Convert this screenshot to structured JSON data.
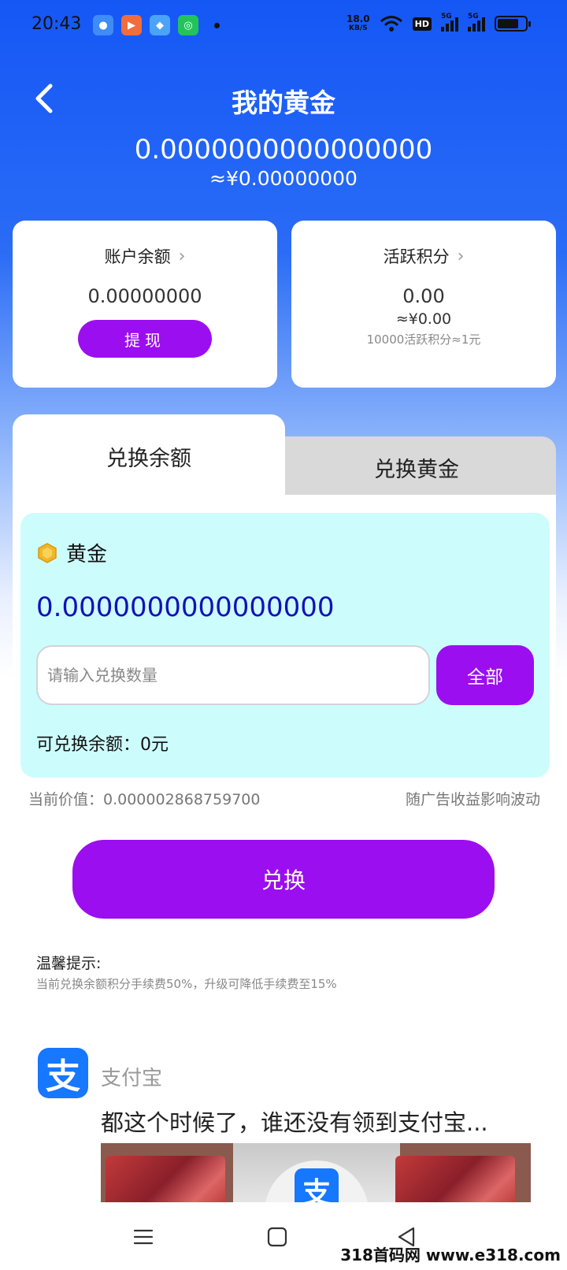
{
  "statusbar": {
    "time": "20:43",
    "net_speed_value": "18.0",
    "net_speed_unit": "KB/S",
    "hd_label": "HD",
    "signal1_label": "5G",
    "signal2_label": "5G",
    "icons": [
      "app-icon-1",
      "app-icon-2",
      "app-icon-3",
      "app-icon-4",
      "wifi-icon",
      "battery-icon"
    ],
    "battery_level": 0.75
  },
  "header": {
    "title": "我的黄金",
    "gold_total": "0.0000000000000000",
    "gold_cny": "≈¥0.00000000"
  },
  "balance_card": {
    "title": "账户余额",
    "value": "0.00000000",
    "button_label": "提现"
  },
  "points_card": {
    "title": "活跃积分",
    "value": "0.00",
    "cny": "≈¥0.00",
    "note": "10000活跃积分≈1元"
  },
  "tabs": [
    {
      "label": "兑换余额",
      "active": true
    },
    {
      "label": "兑换黄金",
      "active": false
    }
  ],
  "exchange": {
    "asset_label": "黄金",
    "asset_amount": "0.0000000000000000",
    "input_placeholder": "请输入兑换数量",
    "input_value": "",
    "all_button": "全部",
    "available": "可兑换余额：0元",
    "price_text": "当前价值：0.000002868759700",
    "fluctuation_text": "随广告收益影响波动",
    "submit_label": "兑换"
  },
  "tips": {
    "title": "温馨提示:",
    "text": "当前兑换余额积分手续费50%，升级可降低手续费至15%"
  },
  "ad": {
    "logo_char": "支",
    "brand": "支付宝",
    "title": "都这个时候了，谁还没有领到支付宝..."
  },
  "watermark": "318首码网 www.e318.com",
  "colors": {
    "primary_blue": "#1557f5",
    "purple": "#9b0ef0",
    "gold_box": "#cdfcfd",
    "gold_amount": "#1212b8",
    "alipay_blue": "#1677ff"
  }
}
